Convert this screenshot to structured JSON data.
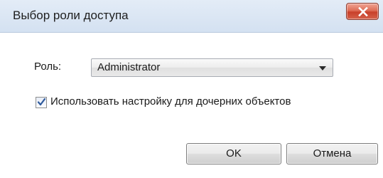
{
  "window": {
    "title": "Выбор роли доступа",
    "close_icon": "close-icon"
  },
  "form": {
    "role_label": "Роль:",
    "role_value": "Administrator",
    "inherit_checked": true,
    "inherit_label": "Использовать настройку для дочерних объектов"
  },
  "buttons": {
    "ok_label": "OK",
    "cancel_label": "Отмена"
  },
  "colors": {
    "title_bar": "#d9e4f2",
    "close_button": "#d5624b",
    "checkmark": "#2e5a9c"
  }
}
